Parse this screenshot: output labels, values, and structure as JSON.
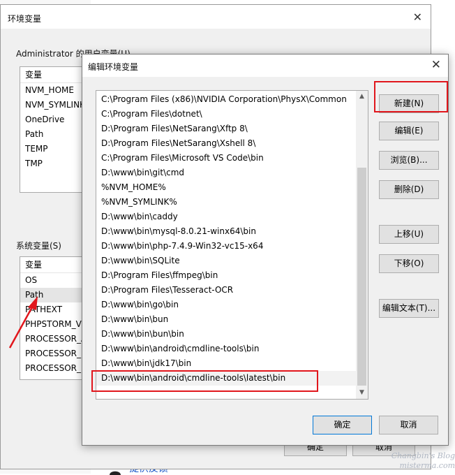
{
  "background": {
    "feedback_label": "提供反馈"
  },
  "env_window": {
    "title": "环境变量",
    "user_section_label": "Administrator 的用户变量(U)",
    "user_vars": {
      "header": "变量",
      "rows": [
        "NVM_HOME",
        "NVM_SYMLINK",
        "OneDrive",
        "Path",
        "TEMP",
        "TMP"
      ]
    },
    "system_section_label": "系统变量(S)",
    "system_vars": {
      "header": "变量",
      "rows": [
        "OS",
        "Path",
        "PATHEXT",
        "PHPSTORM_VM",
        "PROCESSOR_A",
        "PROCESSOR_I",
        "PROCESSOR_L"
      ],
      "selected": "Path"
    },
    "ok_label": "确定",
    "cancel_label": "取消"
  },
  "edit_dialog": {
    "title": "编辑环境变量",
    "paths": [
      "C:\\Program Files (x86)\\NVIDIA Corporation\\PhysX\\Common",
      "C:\\Program Files\\dotnet\\",
      "D:\\Program Files\\NetSarang\\Xftp 8\\",
      "D:\\Program Files\\NetSarang\\Xshell 8\\",
      "C:\\Program Files\\Microsoft VS Code\\bin",
      "D:\\www\\bin\\git\\cmd",
      "%NVM_HOME%",
      "%NVM_SYMLINK%",
      "D:\\www\\bin\\caddy",
      "D:\\www\\bin\\mysql-8.0.21-winx64\\bin",
      "D:\\www\\bin\\php-7.4.9-Win32-vc15-x64",
      "D:\\www\\bin\\SQLite",
      "D:\\Program Files\\ffmpeg\\bin",
      "D:\\Program Files\\Tesseract-OCR",
      "D:\\www\\bin\\go\\bin",
      "D:\\www\\bin\\bun",
      "D:\\www\\bin\\bun\\bin",
      "D:\\www\\bin\\android\\cmdline-tools\\bin",
      "D:\\www\\bin\\jdk17\\bin",
      "D:\\www\\bin\\android\\cmdline-tools\\latest\\bin"
    ],
    "selected_path": "D:\\www\\bin\\android\\cmdline-tools\\latest\\bin",
    "buttons": {
      "new": "新建(N)",
      "edit": "编辑(E)",
      "browse": "浏览(B)...",
      "delete": "删除(D)",
      "move_up": "上移(U)",
      "move_down": "下移(O)",
      "edit_text": "编辑文本(T)..."
    },
    "ok_label": "确定",
    "cancel_label": "取消"
  },
  "watermark": {
    "line1": "Changbin's Blog",
    "line2": "misterma.com"
  },
  "colors": {
    "highlight_red": "#e1161c",
    "accent_blue": "#0078d7",
    "link_blue": "#1a56c6"
  }
}
